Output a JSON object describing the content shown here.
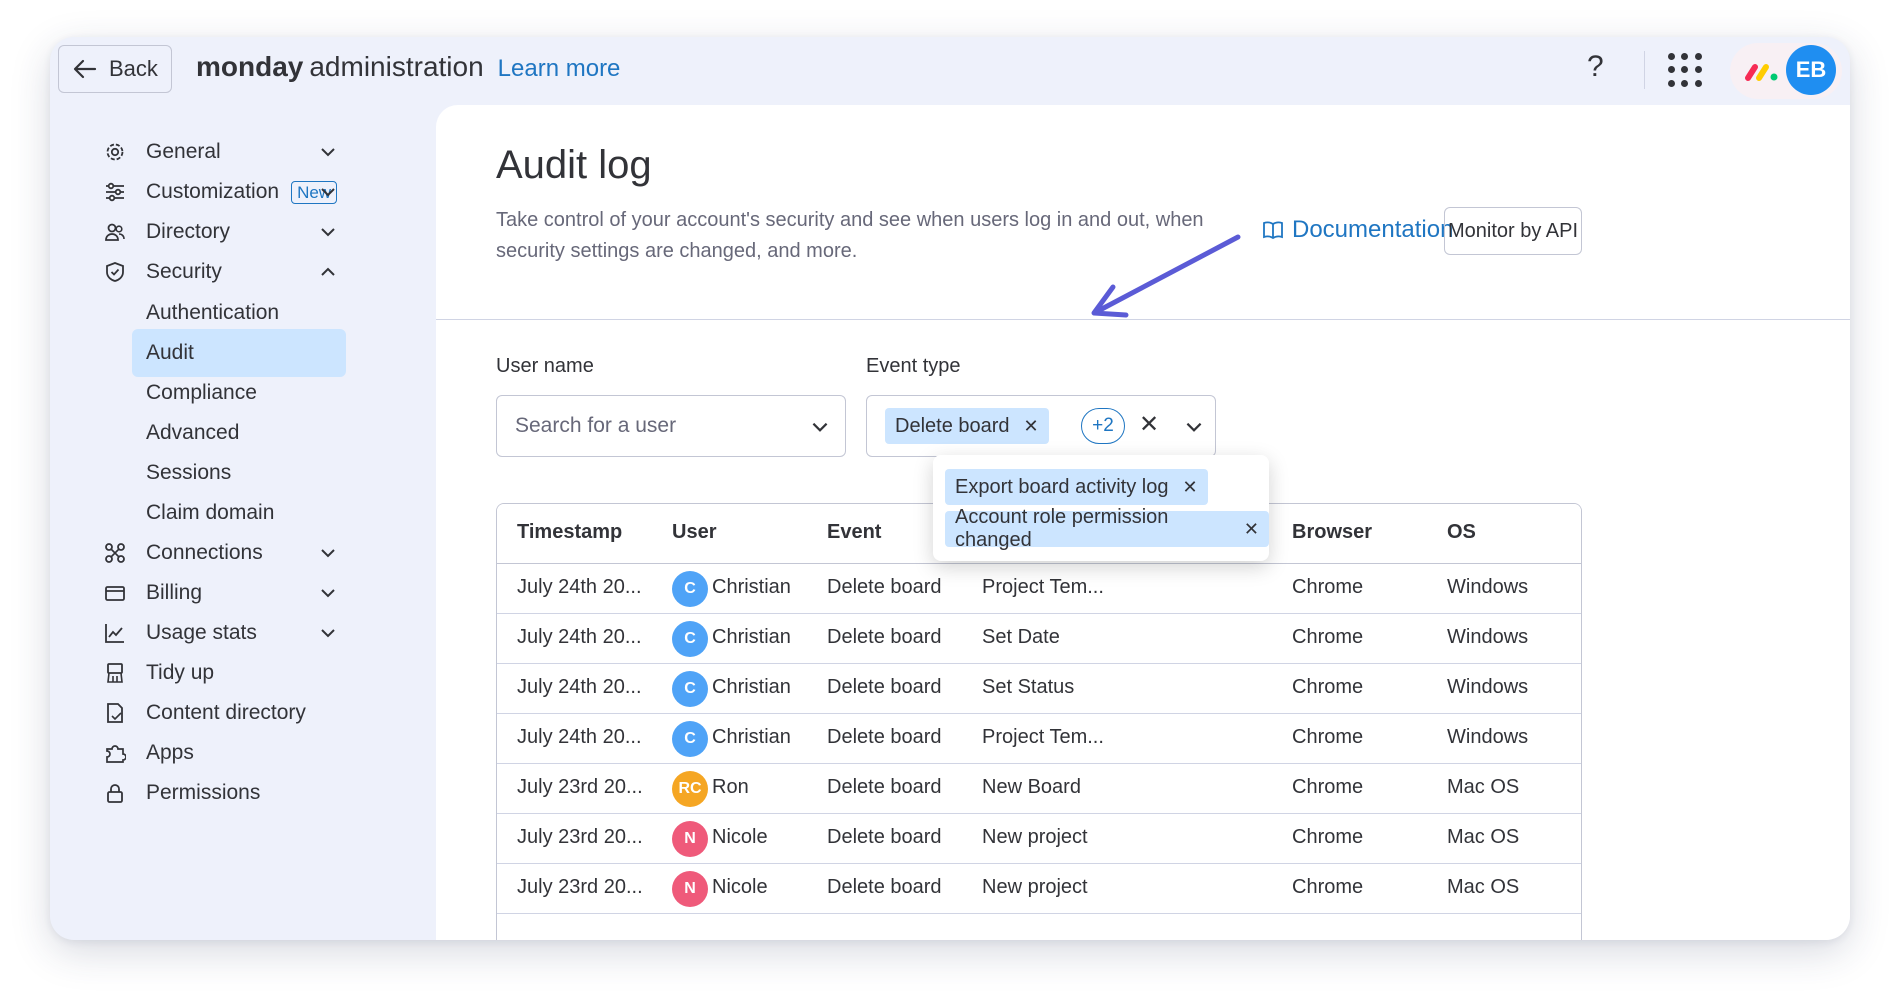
{
  "topbar": {
    "back_label": "Back",
    "brand_bold": "monday",
    "brand_rest": "administration",
    "learn_more": "Learn more",
    "help": "?",
    "avatar_initials": "EB",
    "avatar_color": "#1f8ef1"
  },
  "sidebar": {
    "items": [
      {
        "label": "General",
        "icon": "gear-icon",
        "chevron": "down"
      },
      {
        "label": "Customization",
        "icon": "sliders-icon",
        "badge": "New",
        "chevron": "down"
      },
      {
        "label": "Directory",
        "icon": "users-icon",
        "chevron": "down"
      },
      {
        "label": "Security",
        "icon": "shield-icon",
        "chevron": "up"
      },
      {
        "label": "Connections",
        "icon": "connections-icon",
        "chevron": "down"
      },
      {
        "label": "Billing",
        "icon": "credit-card-icon",
        "chevron": "down"
      },
      {
        "label": "Usage stats",
        "icon": "chart-icon",
        "chevron": "down"
      },
      {
        "label": "Tidy up",
        "icon": "broom-icon"
      },
      {
        "label": "Content directory",
        "icon": "document-icon"
      },
      {
        "label": "Apps",
        "icon": "puzzle-icon"
      },
      {
        "label": "Permissions",
        "icon": "lock-icon"
      }
    ],
    "security_sub": [
      "Authentication",
      "Audit",
      "Compliance",
      "Advanced",
      "Sessions",
      "Claim domain"
    ],
    "active_sub": "Audit"
  },
  "main": {
    "title": "Audit log",
    "description": "Take control of your account's security and see when users log in and out, when security settings are changed, and more.",
    "documentation": "Documentation",
    "monitor_api": "Monitor by API",
    "user_name_label": "User name",
    "user_placeholder": "Search for a user",
    "event_type_label": "Event type",
    "event_chip": "Delete board",
    "event_more": "+2",
    "dropdown_chips": [
      "Export board activity log",
      "Account role permission changed"
    ]
  },
  "table": {
    "columns": [
      "Timestamp",
      "User",
      "Event",
      "Browser",
      "OS"
    ],
    "rows": [
      {
        "timestamp": "July 24th 20...",
        "initials": "C",
        "user": "Christian",
        "avatar_color": "#4fa3f7",
        "event": "Delete board",
        "target": "Project Tem...",
        "browser": "Chrome",
        "os": "Windows"
      },
      {
        "timestamp": "July 24th 20...",
        "initials": "C",
        "user": "Christian",
        "avatar_color": "#4fa3f7",
        "event": "Delete board",
        "target": "Set Date",
        "browser": "Chrome",
        "os": "Windows"
      },
      {
        "timestamp": "July 24th 20...",
        "initials": "C",
        "user": "Christian",
        "avatar_color": "#4fa3f7",
        "event": "Delete board",
        "target": "Set Status",
        "browser": "Chrome",
        "os": "Windows"
      },
      {
        "timestamp": "July 24th 20...",
        "initials": "C",
        "user": "Christian",
        "avatar_color": "#4fa3f7",
        "event": "Delete board",
        "target": "Project Tem...",
        "browser": "Chrome",
        "os": "Windows"
      },
      {
        "timestamp": "July 23rd 20...",
        "initials": "RC",
        "user": "Ron",
        "avatar_color": "#f5a623",
        "event": "Delete board",
        "target": "New Board",
        "browser": "Chrome",
        "os": "Mac OS"
      },
      {
        "timestamp": "July 23rd 20...",
        "initials": "N",
        "user": "Nicole",
        "avatar_color": "#ef5a7a",
        "event": "Delete board",
        "target": "New project",
        "browser": "Chrome",
        "os": "Mac OS"
      },
      {
        "timestamp": "July 23rd 20...",
        "initials": "N",
        "user": "Nicole",
        "avatar_color": "#ef5a7a",
        "event": "Delete board",
        "target": "New project",
        "browser": "Chrome",
        "os": "Mac OS"
      }
    ]
  },
  "colors": {
    "accent": "#1f76c2",
    "selected": "#cce5ff",
    "annotation_arrow": "#5b5bd6"
  }
}
